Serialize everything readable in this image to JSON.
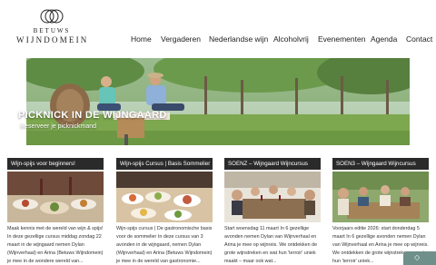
{
  "logo": {
    "line1": "BETUWS",
    "line2": "WIJNDOMEIN"
  },
  "nav": {
    "items": [
      "Home",
      "Vergaderen",
      "Nederlandse wijn",
      "Alcoholvrij",
      "Evenementen",
      "Agenda",
      "Contact"
    ]
  },
  "hero": {
    "title": "PICKNICK IN DE WIJNGAARD",
    "subtitle": "Reserveer je picknickmand"
  },
  "cards": [
    {
      "title": "Wijn-spijs voor beginners!",
      "text": "Maak kennis met de wereld van wijn & spijs! In deze gezellige cursus middag zondag 22 maart in de wijngaard nemen Dylan (Wijnverhaal) en Arina (Betuws Wijndomein) je mee in de wondere wereld van..."
    },
    {
      "title": "Wijn-spijs Cursus | Basis Sommelier",
      "text": "Wijn-spijs cursus | De gastronomische basis voor de sommelier In deze cursus van 3 avonden in de wijngaard, nemen Dylan (Wijnverhaal) en Arina (Betuws Wijndomein) je mee in de wereld van gastronomie..."
    },
    {
      "title": "SOENZ – Wijngaard Wijncursus",
      "text": "Start woensdag 11 maart In 6 gezellige avonden nemen Dylan van Wijnverhaal en Arina je mee op wijnreis. We ontdekken de grote wijnstreken en wat hun 'terroir' uniek maakt – maar ook wat..."
    },
    {
      "title": "SOEN3 – Wijngaard Wijncursus",
      "text": "Voorjaars editie 2026: start donderdag 5 maart In 6 gezellige avonden nemen Dylan van Wijnverhaal en Arina je mee op wijnreis. We ontdekken de grote wijnstreken en wat hun 'terroir' uniek..."
    }
  ],
  "colors": {
    "card_header_bg": "#2a2a2a",
    "badge": "#6e8f8a"
  },
  "icons": {
    "logo": "interlocking-rings-icon",
    "badge": "chat-icon"
  }
}
